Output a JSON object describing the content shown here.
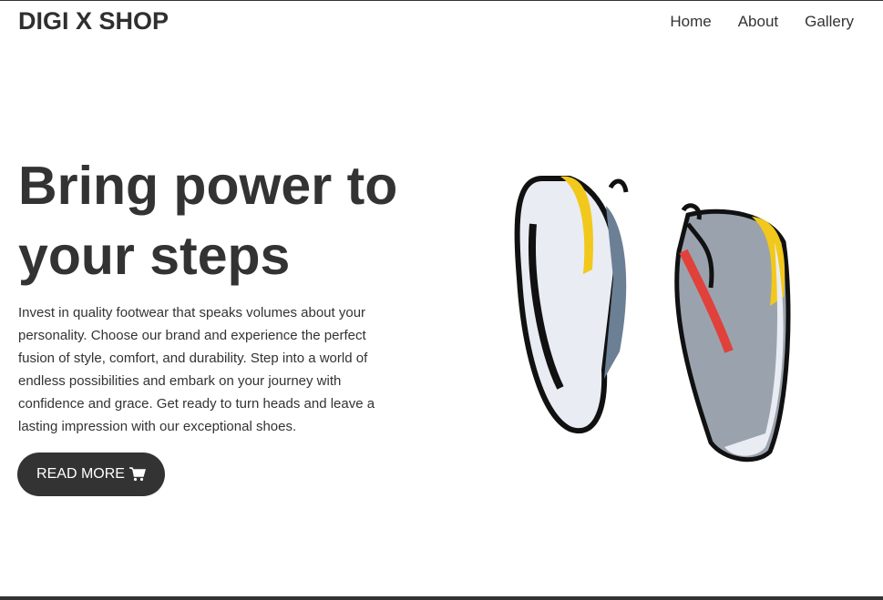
{
  "header": {
    "logo": "DIGI X SHOP",
    "nav": [
      "Home",
      "About",
      "Gallery"
    ]
  },
  "hero": {
    "title": "Bring power to your steps",
    "description": "Invest in quality footwear that speaks volumes about your personality. Choose our brand and experience the perfect fusion of style, comfort, and durability. Step into a world of endless possibilities and embark on your journey with confidence and grace. Get ready to turn heads and leave a lasting impression with our exceptional shoes.",
    "button_label": "READ MORE",
    "button_icon": "cart-icon"
  },
  "colors": {
    "primary": "#333333",
    "accent_yellow": "#f2c81c"
  }
}
